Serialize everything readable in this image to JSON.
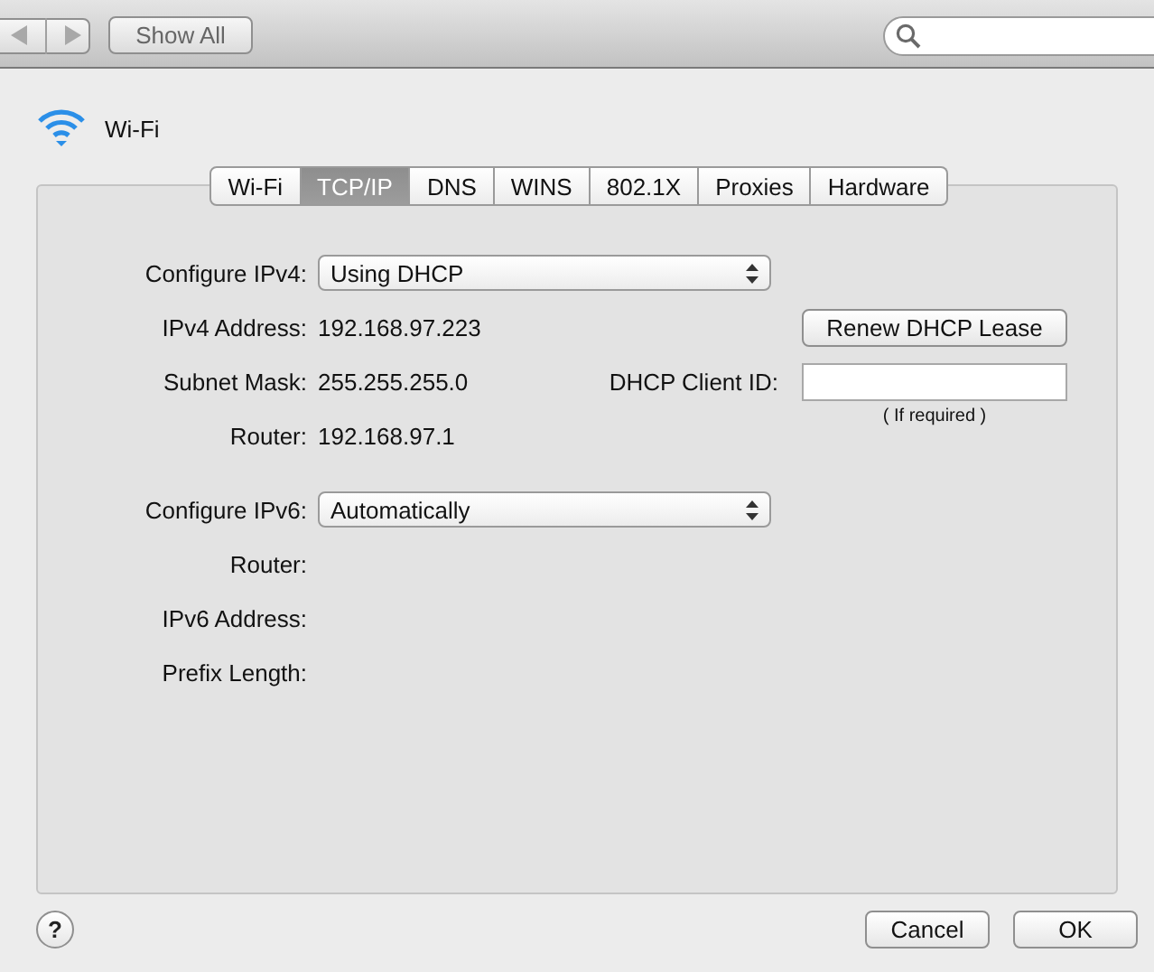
{
  "toolbar": {
    "show_all": "Show All"
  },
  "header": {
    "title": "Wi-Fi"
  },
  "tabs": [
    {
      "label": "Wi-Fi",
      "selected": false
    },
    {
      "label": "TCP/IP",
      "selected": true
    },
    {
      "label": "DNS",
      "selected": false
    },
    {
      "label": "WINS",
      "selected": false
    },
    {
      "label": "802.1X",
      "selected": false
    },
    {
      "label": "Proxies",
      "selected": false
    },
    {
      "label": "Hardware",
      "selected": false
    }
  ],
  "ipv4": {
    "label": "Configure IPv4:",
    "value": "Using DHCP"
  },
  "ipv4_fields": [
    {
      "label": "IPv4 Address:",
      "value": "192.168.97.223"
    },
    {
      "label": "Subnet Mask:",
      "value": "255.255.255.0"
    },
    {
      "label": "Router:",
      "value": "192.168.97.1"
    }
  ],
  "renew_button": "Renew DHCP Lease",
  "client_id": {
    "label": "DHCP Client ID:",
    "hint": "( If required )"
  },
  "ipv6": {
    "label": "Configure IPv6:",
    "value": "Automatically"
  },
  "ipv6_fields": [
    {
      "label": "Router:"
    },
    {
      "label": "IPv6 Address:"
    },
    {
      "label": "Prefix Length:"
    }
  ],
  "buttons": {
    "help": "?",
    "cancel": "Cancel",
    "ok": "OK"
  }
}
